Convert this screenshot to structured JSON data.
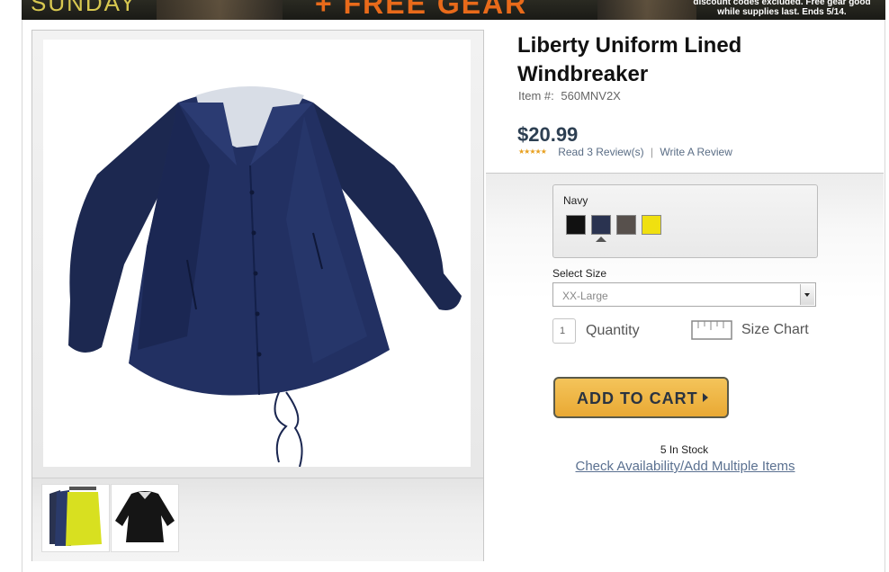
{
  "banner": {
    "left_word": "SUNDAY",
    "center_word": "+ FREE GEAR",
    "fine_print_line1": "discount codes excluded. Free gear good",
    "fine_print_line2": "while supplies last. Ends 5/14."
  },
  "product": {
    "title": "Liberty Uniform Lined Windbreaker",
    "item_label": "Item #:",
    "item_number": "560MNV2X",
    "price": "$20.99",
    "stars": "★★★★★",
    "read_reviews": "Read 3 Review(s)",
    "separator": "|",
    "write_review": "Write A Review"
  },
  "color": {
    "selected_name": "Navy",
    "swatches": [
      {
        "name": "Black",
        "hex": "#111111"
      },
      {
        "name": "Navy",
        "hex": "#2a3350"
      },
      {
        "name": "Charcoal",
        "hex": "#57504c"
      },
      {
        "name": "Yellow",
        "hex": "#f0e010"
      }
    ]
  },
  "size": {
    "label": "Select Size",
    "selected": "XX-Large"
  },
  "quantity": {
    "value": "1",
    "label": "Quantity"
  },
  "size_chart": {
    "label": "Size Chart"
  },
  "cart": {
    "button_label": "ADD TO CART"
  },
  "stock": {
    "text": "5 In Stock",
    "check_link": "Check Availability/Add Multiple Items"
  },
  "colors": {
    "jacket_navy": "#1e2b55",
    "button_gold": "#f0b848",
    "link_blue": "#5a7090",
    "price_blue": "#2d3f52"
  }
}
